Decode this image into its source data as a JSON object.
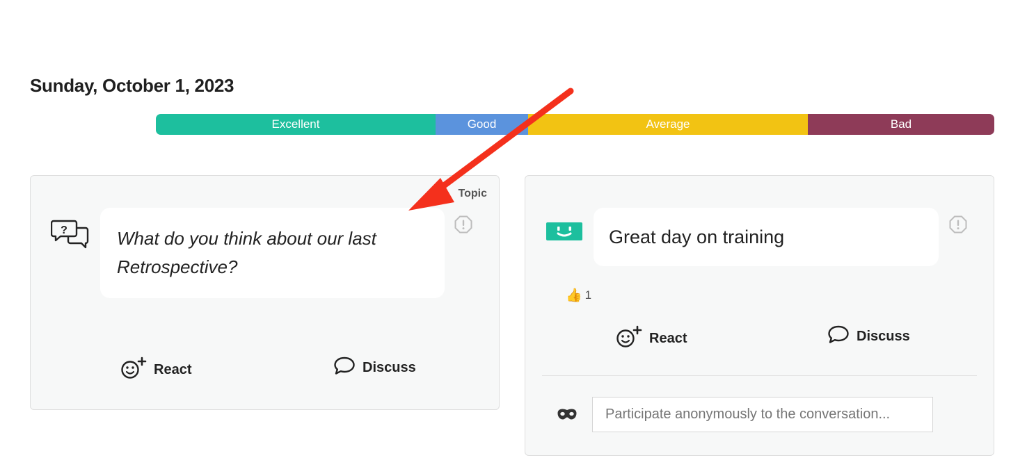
{
  "page": {
    "date": "Sunday, October 1, 2023"
  },
  "mood_bar": {
    "segments": [
      {
        "label": "Excellent",
        "color": "#1dbf9e"
      },
      {
        "label": "Good",
        "color": "#5b93dd"
      },
      {
        "label": "Average",
        "color": "#f2c313"
      },
      {
        "label": "Bad",
        "color": "#8e3b58"
      }
    ]
  },
  "topic_card": {
    "tag": "Topic",
    "icon": "question-chat-icon",
    "text": "What do you think about our last Retrospective?",
    "react_label": "React",
    "discuss_label": "Discuss"
  },
  "feedback_card": {
    "icon": "happy-face-icon",
    "mood_color": "#1dbf9e",
    "text": "Great day on training",
    "reactions": [
      {
        "emoji": "👍",
        "count": "1"
      }
    ],
    "react_label": "React",
    "discuss_label": "Discuss",
    "anonymous_input_placeholder": "Participate anonymously to the conversation...",
    "anonymous_input_value": ""
  },
  "annotation": {
    "arrow_color": "#f4301c"
  }
}
